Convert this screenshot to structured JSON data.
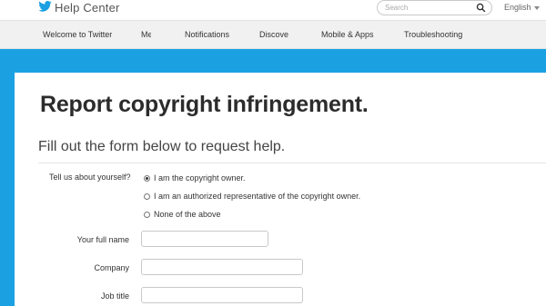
{
  "header": {
    "brand": "Help Center",
    "search_placeholder": "Search",
    "language": "English"
  },
  "nav": {
    "items": [
      "Welcome to Twitter",
      "Me",
      "Notifications",
      "Discover",
      "Mobile & Apps",
      "Troubleshooting"
    ]
  },
  "form": {
    "title": "Report copyright infringement.",
    "subtitle": "Fill out the form below to request help.",
    "question": "Tell us about yourself?",
    "options": [
      "I am the copyright owner.",
      "I am an authorized representative of the copyright owner.",
      "None of the above"
    ],
    "selected_option": 0,
    "fields": [
      {
        "label": "Your full name",
        "value": ""
      },
      {
        "label": "Company",
        "value": ""
      },
      {
        "label": "Job title",
        "value": ""
      }
    ]
  },
  "colors": {
    "accent_blue": "#1ba1e2",
    "nav_background": "#f1f1f1"
  }
}
